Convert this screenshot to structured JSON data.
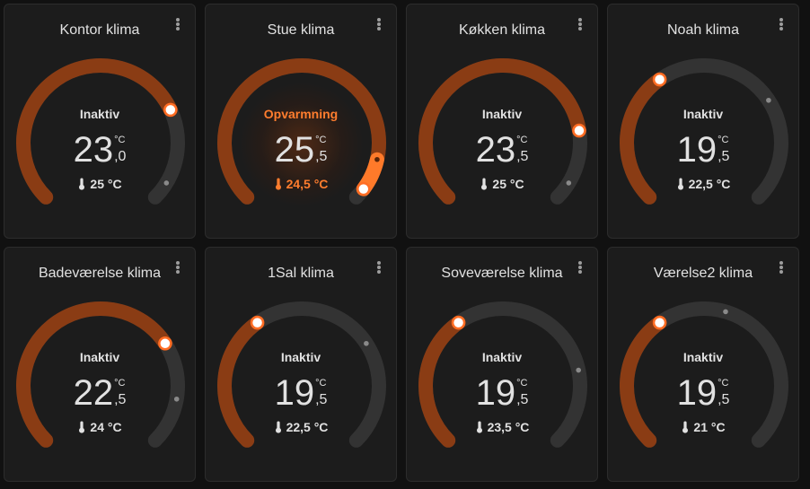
{
  "colors": {
    "track": "#333333",
    "arc_idle": "#8a3c14",
    "arc_heating": "#ff7a2a",
    "handle_fill": "#ffffff",
    "handle_stroke": "#ff6d24",
    "heating_text": "#ff7d2e"
  },
  "cards": [
    {
      "title": "Kontor klima",
      "state": "Inaktiv",
      "target_int": "23",
      "target_dec": ",0",
      "unit": "°C",
      "current": "25 °C",
      "heating": false,
      "target_fraction": 0.74,
      "current_fraction": 0.95,
      "icon": "thermometer-icon"
    },
    {
      "title": "Stue klima",
      "state": "Opvarmning",
      "target_int": "25",
      "target_dec": ",5",
      "unit": "°C",
      "current": "24,5 °C",
      "heating": true,
      "target_fraction": 0.97,
      "current_fraction": 0.88,
      "icon": "thermometer-icon"
    },
    {
      "title": "Køkken klima",
      "state": "Inaktiv",
      "target_int": "23",
      "target_dec": ",5",
      "unit": "°C",
      "current": "25 °C",
      "heating": false,
      "target_fraction": 0.8,
      "current_fraction": 0.95,
      "icon": "thermometer-icon"
    },
    {
      "title": "Noah klima",
      "state": "Inaktiv",
      "target_int": "19",
      "target_dec": ",5",
      "unit": "°C",
      "current": "22,5 °C",
      "heating": false,
      "target_fraction": 0.37,
      "current_fraction": 0.71,
      "icon": "thermometer-icon"
    },
    {
      "title": "Badeværelse klima",
      "state": "Inaktiv",
      "target_int": "22",
      "target_dec": ",5",
      "unit": "°C",
      "current": "24 °C",
      "heating": false,
      "target_fraction": 0.71,
      "current_fraction": 0.87,
      "icon": "thermometer-icon"
    },
    {
      "title": "1Sal klima",
      "state": "Inaktiv",
      "target_int": "19",
      "target_dec": ",5",
      "unit": "°C",
      "current": "22,5 °C",
      "heating": false,
      "target_fraction": 0.37,
      "current_fraction": 0.71,
      "icon": "thermometer-icon"
    },
    {
      "title": "Soveværelse klima",
      "state": "Inaktiv",
      "target_int": "19",
      "target_dec": ",5",
      "unit": "°C",
      "current": "23,5 °C",
      "heating": false,
      "target_fraction": 0.37,
      "current_fraction": 0.79,
      "icon": "thermometer-icon"
    },
    {
      "title": "Værelse2 klima",
      "state": "Inaktiv",
      "target_int": "19",
      "target_dec": ",5",
      "unit": "°C",
      "current": "21 °C",
      "heating": false,
      "target_fraction": 0.37,
      "current_fraction": 0.56,
      "icon": "thermometer-icon"
    }
  ]
}
